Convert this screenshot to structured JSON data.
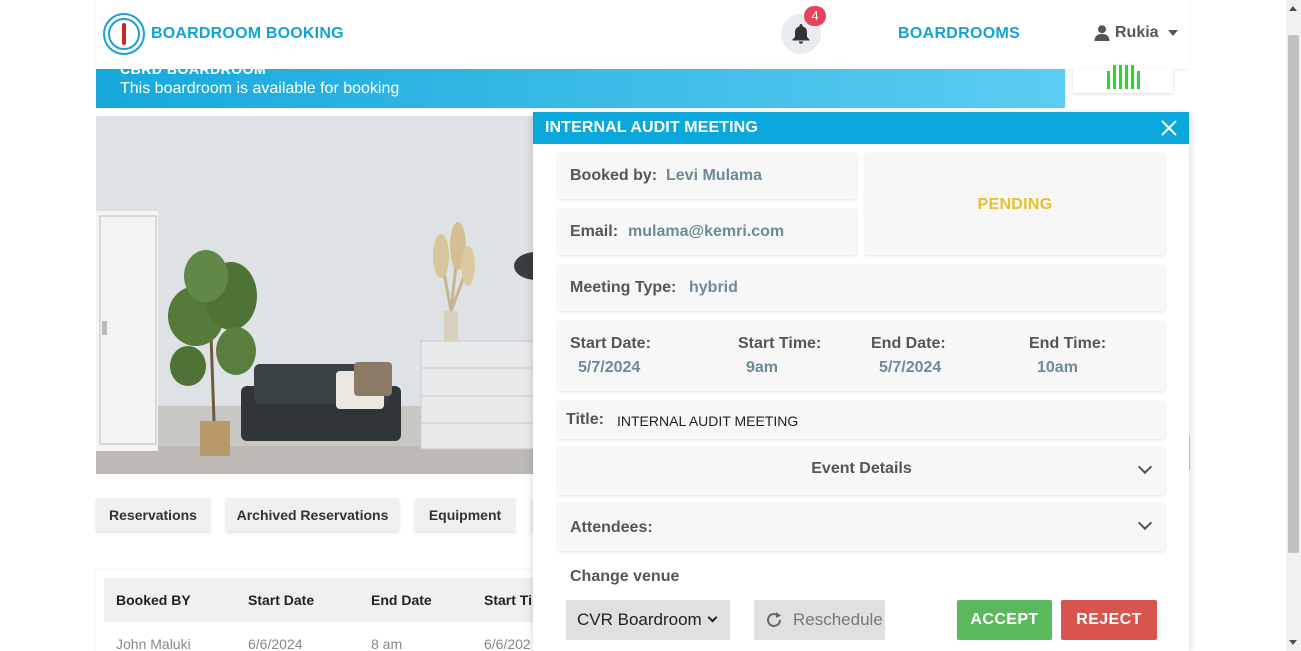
{
  "navbar": {
    "brand": "BOARDROOM BOOKING",
    "notification_count": "4",
    "nav_link": "BOARDROOMS",
    "user_name": "Rukia"
  },
  "banner": {
    "title": "CBRD BOARDROOM",
    "availability_text": "This boardroom is available for booking"
  },
  "tabs": [
    "Reservations",
    "Archived Reservations",
    "Equipment"
  ],
  "table": {
    "headers": [
      "Booked BY",
      "Start Date",
      "End Date",
      "Start Ti"
    ],
    "rows": [
      [
        "John Maluki",
        "6/6/2024",
        "8 am",
        "6/6/202"
      ]
    ]
  },
  "modal": {
    "title": "INTERNAL AUDIT MEETING",
    "booked_by_label": "Booked by:",
    "booked_by_value": "Levi Mulama",
    "email_label": "Email:",
    "email_value": "mulama@kemri.com",
    "status": "PENDING",
    "meeting_type_label": "Meeting Type:",
    "meeting_type_value": "hybrid",
    "start_date_label": "Start Date:",
    "start_date_value": "5/7/2024",
    "start_time_label": "Start Time:",
    "start_time_value": "9am",
    "end_date_label": "End Date:",
    "end_date_value": "5/7/2024",
    "end_time_label": "End Time:",
    "end_time_value": "10am",
    "title_label": "Title:",
    "title_value": "INTERNAL AUDIT MEETING",
    "event_details_label": "Event Details",
    "attendees_label": "Attendees:",
    "change_venue_label": "Change venue",
    "venue_selected": "CVR Boardroom",
    "reschedule_label": "Reschedule",
    "accept_label": "ACCEPT",
    "reject_label": "REJECT"
  },
  "colors": {
    "brand": "#0ea5d6",
    "modal_header": "#0aa8dc",
    "pending": "#e6c02a",
    "accept": "#5cb85c",
    "reject": "#d9534f",
    "badge": "#e5455a"
  },
  "icons": {
    "logo": "kemri-logo-icon",
    "notifications": "bell-icon",
    "user": "user-icon",
    "close": "close-icon",
    "reschedule": "refresh-icon",
    "expand": "chevron-down-icon"
  }
}
